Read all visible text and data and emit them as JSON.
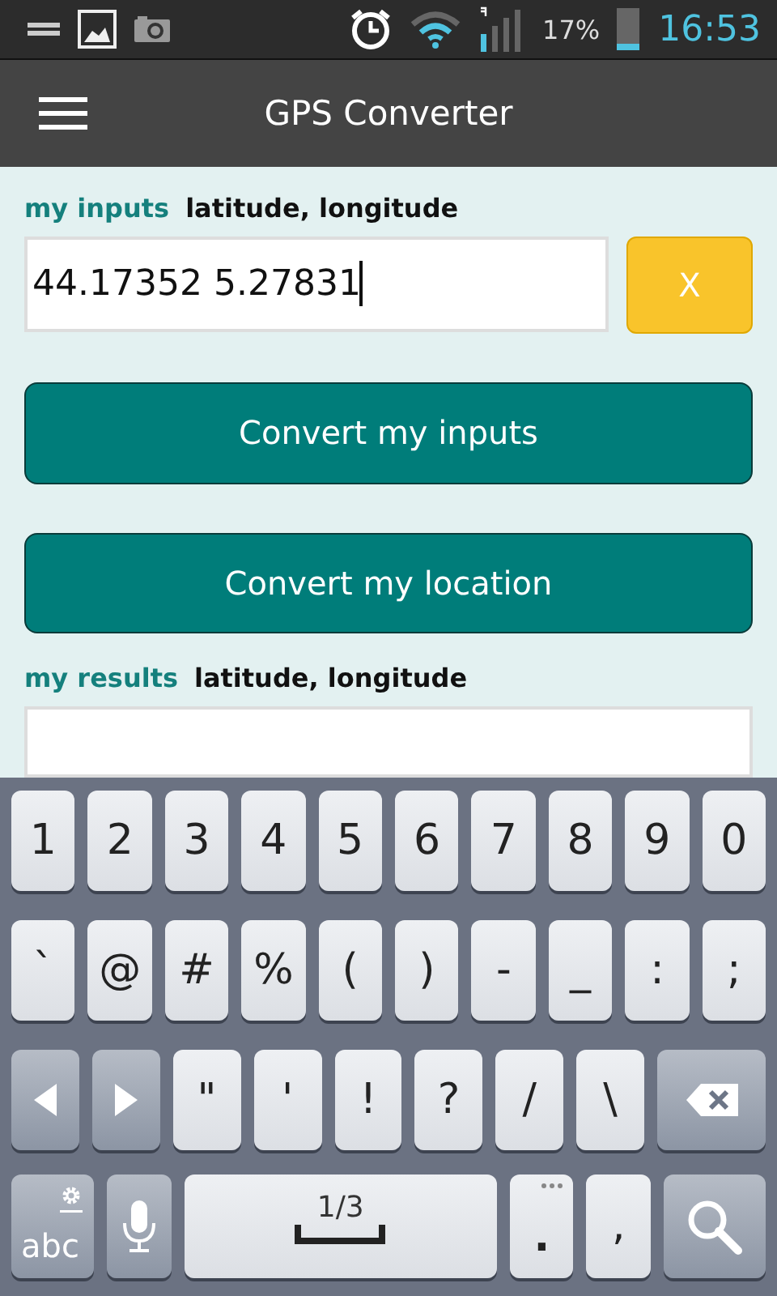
{
  "status_bar": {
    "battery_percent": "17%",
    "time": "16:53"
  },
  "app_bar": {
    "title": "GPS Converter"
  },
  "inputs": {
    "label": "my inputs",
    "hint": "latitude, longitude",
    "value": "44.17352 5.27831",
    "clear_button": "X"
  },
  "buttons": [
    "Convert my inputs",
    "Convert my location"
  ],
  "results": {
    "label": "my results",
    "hint": "latitude, longitude"
  },
  "keyboard": {
    "rows": [
      {
        "keys": [
          {
            "kind": "char",
            "label": "1"
          },
          {
            "kind": "char",
            "label": "2"
          },
          {
            "kind": "char",
            "label": "3"
          },
          {
            "kind": "char",
            "label": "4"
          },
          {
            "kind": "char",
            "label": "5"
          },
          {
            "kind": "char",
            "label": "6"
          },
          {
            "kind": "char",
            "label": "7"
          },
          {
            "kind": "char",
            "label": "8"
          },
          {
            "kind": "char",
            "label": "9"
          },
          {
            "kind": "char",
            "label": "0"
          }
        ]
      },
      {
        "keys": [
          {
            "kind": "char",
            "label": "`"
          },
          {
            "kind": "char",
            "label": "@"
          },
          {
            "kind": "char",
            "label": "#"
          },
          {
            "kind": "char",
            "label": "%"
          },
          {
            "kind": "char",
            "label": "("
          },
          {
            "kind": "char",
            "label": ")"
          },
          {
            "kind": "char",
            "label": "-"
          },
          {
            "kind": "char",
            "label": "_"
          },
          {
            "kind": "char",
            "label": ":"
          },
          {
            "kind": "char",
            "label": ";"
          }
        ]
      },
      {
        "keys": [
          {
            "kind": "left"
          },
          {
            "kind": "right"
          },
          {
            "kind": "char",
            "label": "\""
          },
          {
            "kind": "char",
            "label": "'"
          },
          {
            "kind": "char",
            "label": "!"
          },
          {
            "kind": "char",
            "label": "?"
          },
          {
            "kind": "char",
            "label": "/"
          },
          {
            "kind": "char",
            "label": "\\"
          },
          {
            "kind": "backspace"
          }
        ]
      },
      {
        "keys": [
          {
            "kind": "mode",
            "label": "abc"
          },
          {
            "kind": "mic"
          },
          {
            "kind": "space",
            "label": "1/3"
          },
          {
            "kind": "more",
            "label": "."
          },
          {
            "kind": "char",
            "label": ","
          },
          {
            "kind": "search"
          }
        ]
      }
    ]
  }
}
